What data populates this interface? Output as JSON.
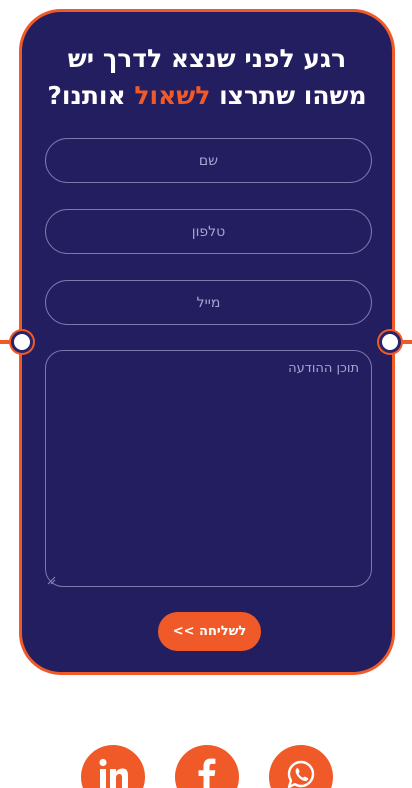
{
  "form": {
    "headline_main": "רגע לפני שנצא לדרך יש משהו שתרצו ",
    "headline_accent": "לשאול",
    "headline_end": " אותנו?",
    "name_placeholder": "שם",
    "phone_placeholder": "טלפון",
    "email_placeholder": "מייל",
    "message_placeholder": "תוכן ההודעה",
    "submit_label": "לשליחה >>"
  },
  "social": {
    "items": [
      {
        "icon": "linkedin-icon"
      },
      {
        "icon": "facebook-icon"
      },
      {
        "icon": "whatsapp-icon"
      }
    ]
  },
  "colors": {
    "card_background": "#231e5f",
    "accent": "#f05a28",
    "text": "#ffffff"
  }
}
